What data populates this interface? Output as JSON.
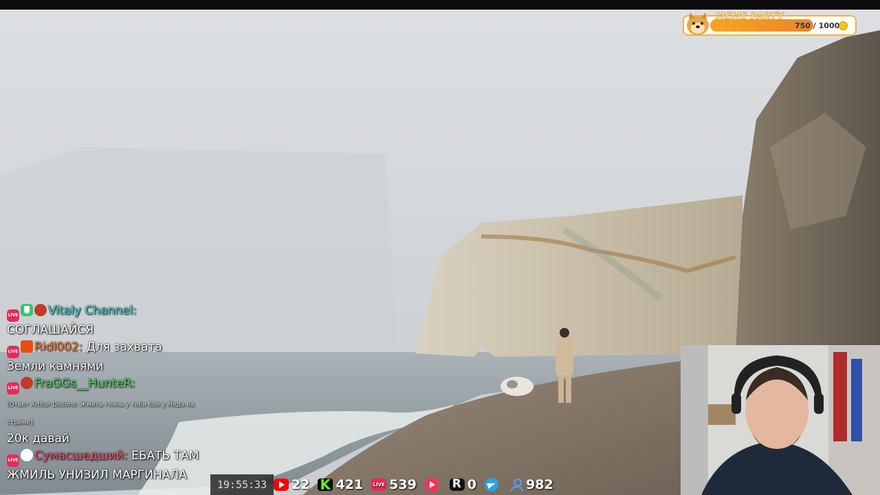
{
  "meme_party": {
    "title": "MEME PARTY",
    "progress_text": "750 / 1000",
    "progress_fraction": 0.75,
    "icon": "doge-icon",
    "coin_icon": "coin-icon"
  },
  "chat": [
    {
      "badges": [
        "live-badge",
        "shield-badge",
        "avatar-badge"
      ],
      "nick": "Vitaly Channel:",
      "nick_color": "#3dd6d0",
      "text": "СОГЛАШАЙСЯ",
      "small": false
    },
    {
      "badges": [
        "live-badge",
        "avatar-badge"
      ],
      "nick": "Ridl002:",
      "nick_color": "#ff7a2a",
      "text": "Для захвата Земли камнями",
      "small": false
    },
    {
      "badges": [
        "live-badge",
        "avatar-badge"
      ],
      "nick": "FraGGs__HunteR:",
      "nick_color": "#4cd964",
      "text": "[Ответ Arthur Distone: Жмиль глянь у тебя бой у Меда на стриме]",
      "small": true
    },
    {
      "badges": [],
      "nick": "",
      "nick_color": "#ffffff",
      "text": "20к давай",
      "small": false
    },
    {
      "badges": [
        "live-badge",
        "avatar-badge"
      ],
      "nick": "Сумасшедший:",
      "nick_color": "#ff4d6d",
      "text": "ЕБАТЬ ТАМ ЖМИЛЬ УНИЗИЛ МАРГИНАЛА",
      "small": false
    }
  ],
  "stream_time": "19:55:33",
  "stats": [
    {
      "icon": "youtube-icon",
      "value": "22"
    },
    {
      "icon": "kick-icon",
      "value": "421"
    },
    {
      "icon": "vk-live-icon",
      "value": "539"
    },
    {
      "icon": "vk-play-icon",
      "value": ""
    },
    {
      "icon": "rutube-icon",
      "value": "0"
    },
    {
      "icon": "telegram-icon",
      "value": ""
    },
    {
      "icon": "viewers-icon",
      "value": "982"
    }
  ],
  "colors": {
    "accent": "#f7a520",
    "live": "#e62b5a",
    "viewers": "#4aa3ff"
  }
}
